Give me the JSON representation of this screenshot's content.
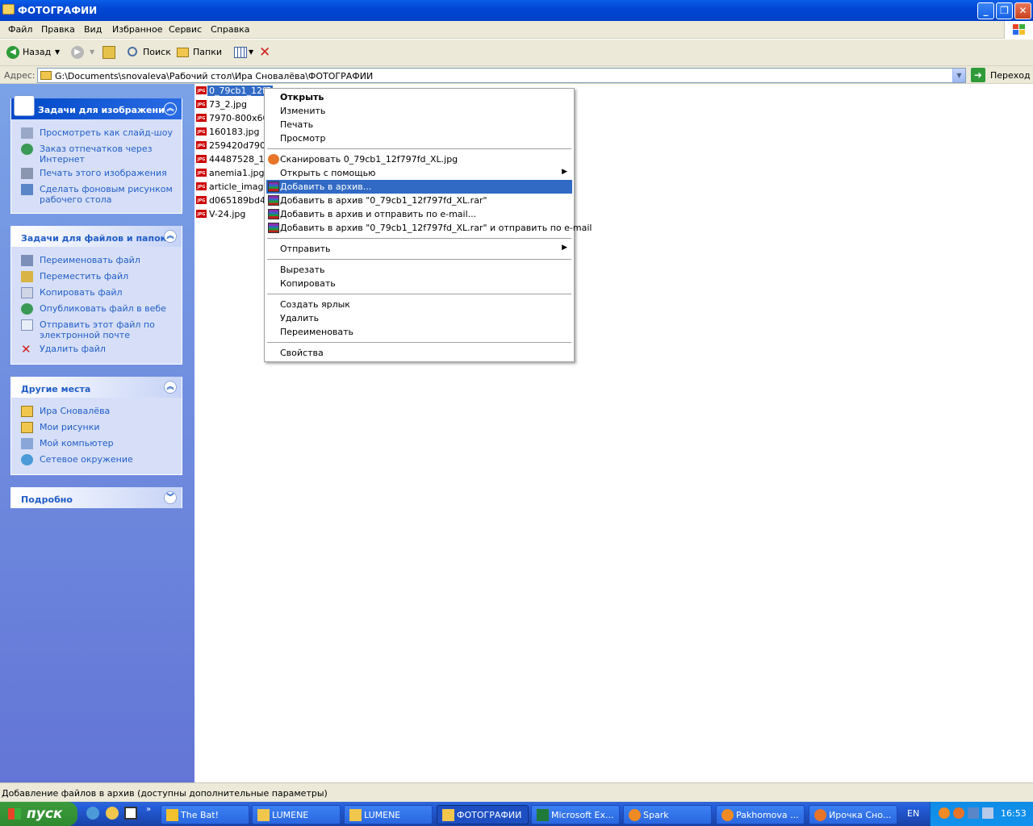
{
  "window": {
    "title": "ФОТОГРАФИИ"
  },
  "menu": [
    "Файл",
    "Правка",
    "Вид",
    "Избранное",
    "Сервис",
    "Справка"
  ],
  "toolbar": {
    "back": "Назад",
    "search": "Поиск",
    "folders": "Папки"
  },
  "address": {
    "label": "Адрес:",
    "path": "G:\\Documents\\snovaleva\\Рабочий стол\\Ира Сновалёва\\ФОТОГРАФИИ",
    "go": "Переход"
  },
  "panels": {
    "image_tasks": {
      "title": "Задачи для изображений",
      "items": [
        "Просмотреть как слайд-шоу",
        "Заказ отпечатков через Интернет",
        "Печать этого изображения",
        "Сделать фоновым рисунком рабочего стола"
      ]
    },
    "file_tasks": {
      "title": "Задачи для файлов и папок",
      "items": [
        "Переименовать файл",
        "Переместить файл",
        "Копировать файл",
        "Опубликовать файл в вебе",
        "Отправить этот файл по электронной почте",
        "Удалить файл"
      ]
    },
    "other_places": {
      "title": "Другие места",
      "items": [
        "Ира Сновалёва",
        "Мои рисунки",
        "Мой компьютер",
        "Сетевое окружение"
      ]
    },
    "details": {
      "title": "Подробно"
    }
  },
  "files": [
    "0_79cb1_12f7",
    "73_2.jpg",
    "7970-800x600",
    "160183.jpg",
    "259420d7904",
    "44487528_12",
    "anemia1.jpg",
    "article_image-",
    "d065189bd416",
    "V-24.jpg"
  ],
  "file_icon_label": "JPG",
  "context_menu": {
    "open": "Открыть",
    "edit": "Изменить",
    "print": "Печать",
    "preview": "Просмотр",
    "scan": "Сканировать 0_79cb1_12f797fd_XL.jpg",
    "open_with": "Открыть с помощью",
    "add_archive": "Добавить в архив...",
    "add_archive_named": "Добавить в архив \"0_79cb1_12f797fd_XL.rar\"",
    "add_archive_email": "Добавить в архив и отправить по e-mail...",
    "add_archive_named_email": "Добавить в архив \"0_79cb1_12f797fd_XL.rar\" и отправить по e-mail",
    "send_to": "Отправить",
    "cut": "Вырезать",
    "copy": "Копировать",
    "create_shortcut": "Создать ярлык",
    "delete": "Удалить",
    "rename": "Переименовать",
    "properties": "Свойства"
  },
  "status": "Добавление файлов в архив (доступны дополнительные параметры)",
  "taskbar": {
    "start": "пуск",
    "tasks": [
      "The Bat!",
      "LUMENE",
      "LUMENE",
      "ФОТОГРАФИИ",
      "Microsoft Ex...",
      "Spark",
      "Pakhomova ...",
      "Ирочка Сно..."
    ],
    "lang": "EN",
    "clock": "16:53"
  }
}
